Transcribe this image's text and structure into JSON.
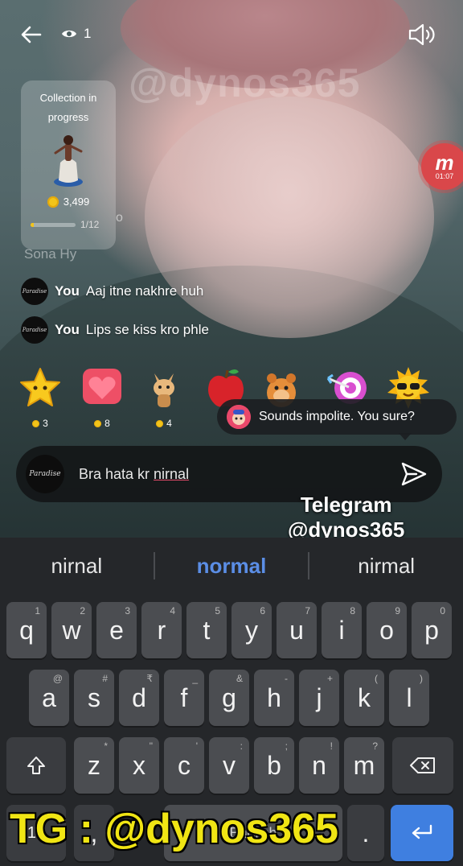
{
  "stream": {
    "viewer_count": "1",
    "watermark": "@dynos365",
    "rec_badge_time": "01:07",
    "rec_badge_mark": "m"
  },
  "collection": {
    "title": "Collection in progress",
    "coins": "3,499",
    "progress_label": "1/12",
    "progress_fraction": 0.08
  },
  "chat": {
    "partial_line": "Sona Hy",
    "partial_line2": "o",
    "messages": [
      {
        "avatar": "Paradise",
        "user": "You",
        "text": "Aaj itne nakhre huh"
      },
      {
        "avatar": "Paradise",
        "user": "You",
        "text": "Lips se kiss kro phle"
      }
    ]
  },
  "gifts": [
    {
      "icon": "star-gift-icon",
      "price": "3"
    },
    {
      "icon": "heart-gift-icon",
      "price": "8"
    },
    {
      "icon": "cat-gift-icon",
      "price": "4"
    },
    {
      "icon": "apple-gift-icon",
      "price": ""
    },
    {
      "icon": "hamster-gift-icon",
      "price": ""
    },
    {
      "icon": "target-gift-icon",
      "price": ""
    },
    {
      "icon": "sun-gift-icon",
      "price": ""
    }
  ],
  "tooltip": {
    "text": "Sounds impolite. You sure?"
  },
  "composer": {
    "avatar": "Paradise",
    "text_prefix": "Bra hata kr ",
    "text_underlined": "nirnal"
  },
  "overlay": {
    "telegram_line1": "Telegram",
    "telegram_line2": "@dynos365",
    "bottom_banner": "TG : @dynos365"
  },
  "keyboard": {
    "suggestions": [
      "nirnal",
      "normal",
      "nirmal"
    ],
    "row1": [
      {
        "k": "q",
        "h": "1"
      },
      {
        "k": "w",
        "h": "2"
      },
      {
        "k": "e",
        "h": "3"
      },
      {
        "k": "r",
        "h": "4"
      },
      {
        "k": "t",
        "h": "5"
      },
      {
        "k": "y",
        "h": "6"
      },
      {
        "k": "u",
        "h": "7"
      },
      {
        "k": "i",
        "h": "8"
      },
      {
        "k": "o",
        "h": "9"
      },
      {
        "k": "p",
        "h": "0"
      }
    ],
    "row2": [
      {
        "k": "a",
        "h": "@"
      },
      {
        "k": "s",
        "h": "#"
      },
      {
        "k": "d",
        "h": "₹"
      },
      {
        "k": "f",
        "h": "_"
      },
      {
        "k": "g",
        "h": "&"
      },
      {
        "k": "h",
        "h": "-"
      },
      {
        "k": "j",
        "h": "+"
      },
      {
        "k": "k",
        "h": "("
      },
      {
        "k": "l",
        "h": ")"
      }
    ],
    "row3": [
      {
        "k": "z",
        "h": "*"
      },
      {
        "k": "x",
        "h": "\""
      },
      {
        "k": "c",
        "h": "'"
      },
      {
        "k": "v",
        "h": ":"
      },
      {
        "k": "b",
        "h": ";"
      },
      {
        "k": "n",
        "h": "!"
      },
      {
        "k": "m",
        "h": "?"
      }
    ],
    "symbols_label": "12",
    "comma_label": ",",
    "space_label": "English",
    "period_label": "."
  }
}
